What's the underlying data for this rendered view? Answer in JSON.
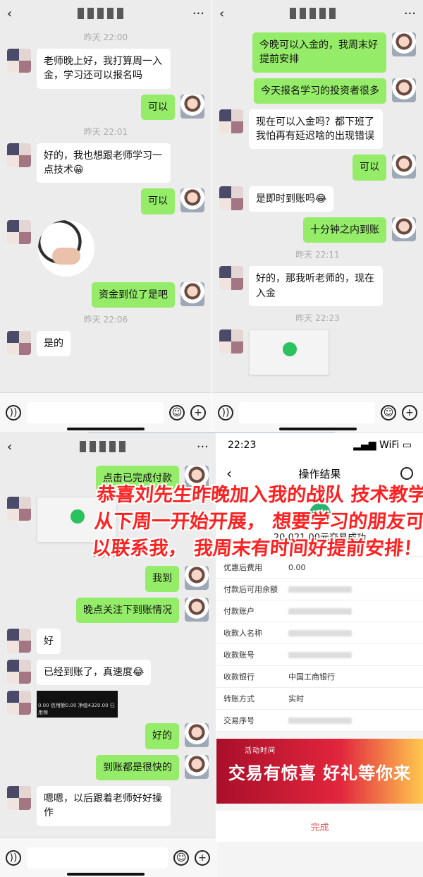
{
  "chat1": {
    "title": "",
    "more": "···",
    "messages": [
      {
        "type": "time",
        "text": "昨天 22:00"
      },
      {
        "side": "left",
        "text": "老师晚上好，我打算周一入金，学习还可以报名吗"
      },
      {
        "side": "right",
        "text": "可以"
      },
      {
        "type": "time",
        "text": "昨天 22:01"
      },
      {
        "side": "left",
        "text": "好的，我也想跟老师学习一点技术😀"
      },
      {
        "side": "right",
        "text": "可以"
      },
      {
        "side": "left",
        "type": "sticker",
        "text": ""
      },
      {
        "side": "right",
        "text": "资金到位了是吧"
      },
      {
        "type": "time",
        "text": "昨天 22:06"
      },
      {
        "side": "left",
        "text": "是的"
      }
    ]
  },
  "chat2": {
    "title": "",
    "more": "···",
    "messages": [
      {
        "side": "right",
        "text": "今晚可以入金的，我周末好提前安排"
      },
      {
        "side": "right",
        "text": "今天报名学习的投资者很多"
      },
      {
        "side": "left",
        "text": "现在可以入金吗？都下班了我怕再有延迟啥的出现错误"
      },
      {
        "side": "right",
        "text": "可以"
      },
      {
        "side": "left",
        "text": "是即时到账吗😂"
      },
      {
        "side": "right",
        "text": "十分钟之内到账"
      },
      {
        "type": "time",
        "text": "昨天 22:11"
      },
      {
        "side": "left",
        "text": "好的，那我听老师的，现在入金"
      },
      {
        "type": "time",
        "text": "昨天 22:23"
      },
      {
        "side": "left",
        "type": "image",
        "text": ""
      }
    ]
  },
  "chat3": {
    "title": "",
    "more": "···",
    "messages": [
      {
        "side": "right",
        "text": "点击已完成付款"
      },
      {
        "side": "left",
        "type": "image",
        "text": ""
      },
      {
        "type": "time",
        "text": "昨天 22"
      },
      {
        "side": "right",
        "text": "我到"
      },
      {
        "side": "right",
        "text": "晚点关注下到账情况"
      },
      {
        "side": "left",
        "text": "好"
      },
      {
        "side": "left",
        "text": "已经到账了，真速度😂"
      },
      {
        "side": "left",
        "type": "dark",
        "text": "0.00 信用额0.00 净值4320.00 已用保"
      },
      {
        "side": "right",
        "text": "好的"
      },
      {
        "side": "right",
        "text": "到账都是很快的"
      },
      {
        "side": "left",
        "text": "嗯嗯，以后跟着老师好好操作"
      }
    ]
  },
  "receipt": {
    "time": "22:23",
    "signal": "▂▄▆ WiFi ▭",
    "title": "操作结果",
    "status": "20,021.00元交易成功",
    "rows": [
      {
        "label": "优惠后费用",
        "value": "0.00"
      },
      {
        "label": "付款后可用余额",
        "value": ""
      },
      {
        "label": "付款账户",
        "value": ""
      },
      {
        "label": "收款人名称",
        "value": ""
      },
      {
        "label": "收款账号",
        "value": ""
      },
      {
        "label": "收款银行",
        "value": "中国工商银行"
      },
      {
        "label": "转账方式",
        "value": "实时"
      },
      {
        "label": "交易序号",
        "value": ""
      }
    ],
    "promo": "交易有惊喜 好礼等你来",
    "done": "完成"
  },
  "caption": "恭喜刘先生昨晚加入我的战队 技术教学从下周一开始开展， 想要学习的朋友可以联系我， 我周末有时间好提前安排！",
  "colors": {
    "chat_bg": "#ededed",
    "sent_bubble": "#95ec69",
    "caption": "#ff2020"
  }
}
